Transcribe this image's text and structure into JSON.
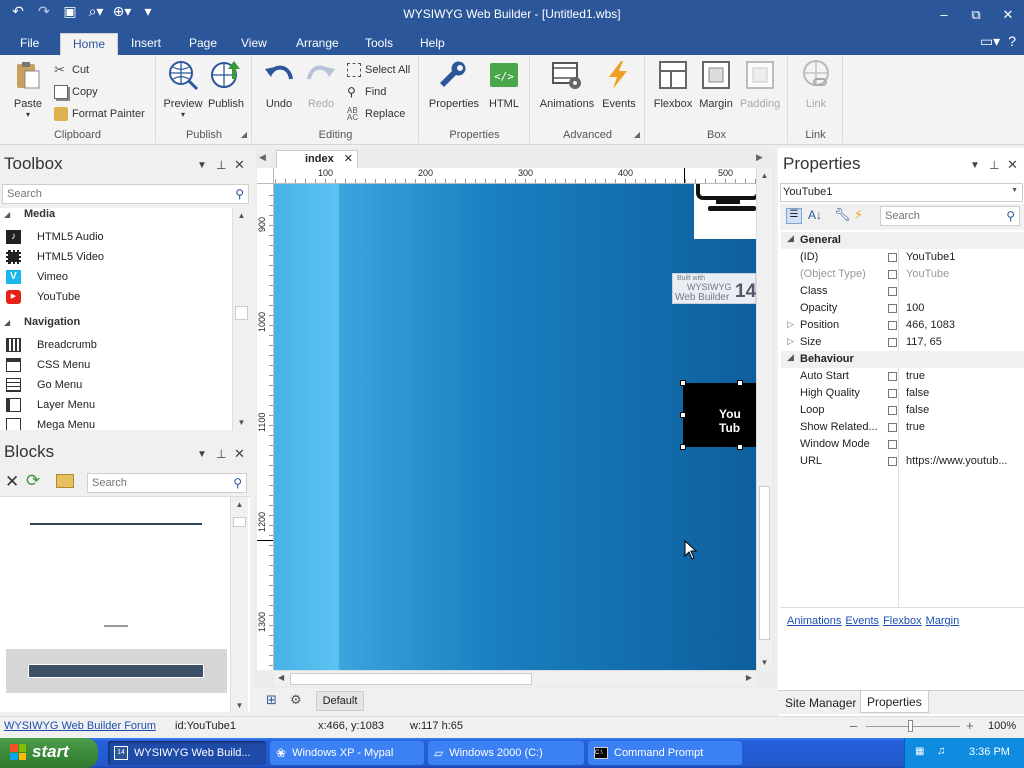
{
  "window": {
    "title": "WYSIWYG Web Builder - [Untitled1.wbs]",
    "controls": [
      "–",
      "⧉",
      "✕"
    ]
  },
  "ribbon_tabs": [
    "File",
    "Home",
    "Insert",
    "Page",
    "View",
    "Arrange",
    "Tools",
    "Help"
  ],
  "ribbon": {
    "clipboard": {
      "label": "Clipboard",
      "paste": "Paste",
      "cut": "Cut",
      "copy": "Copy",
      "format_painter": "Format Painter"
    },
    "publish": {
      "label": "Publish",
      "preview": "Preview",
      "publish": "Publish"
    },
    "editing": {
      "label": "Editing",
      "undo": "Undo",
      "redo": "Redo",
      "select_all": "Select All",
      "find": "Find",
      "replace": "Replace"
    },
    "properties": {
      "label": "Properties",
      "properties": "Properties",
      "html": "HTML"
    },
    "advanced": {
      "label": "Advanced",
      "animations": "Animations",
      "events": "Events"
    },
    "box": {
      "label": "Box",
      "flexbox": "Flexbox",
      "margin": "Margin",
      "padding": "Padding"
    },
    "link": {
      "label": "Link",
      "link": "Link"
    }
  },
  "toolbox": {
    "title": "Toolbox",
    "search_placeholder": "Search",
    "categories": [
      {
        "name": "Media",
        "items": [
          "HTML5 Audio",
          "HTML5 Video",
          "Vimeo",
          "YouTube"
        ]
      },
      {
        "name": "Navigation",
        "items": [
          "Breadcrumb",
          "CSS Menu",
          "Go Menu",
          "Layer Menu",
          "Mega Menu"
        ]
      }
    ]
  },
  "blocks": {
    "title": "Blocks",
    "search_placeholder": "Search"
  },
  "document": {
    "tab_name": "index",
    "ruler_h": [
      "100",
      "200",
      "300",
      "400",
      "500"
    ],
    "ruler_v": [
      "900",
      "1000",
      "1100",
      "1200",
      "1300"
    ],
    "layout_label": "Default",
    "badge_line1": "Built with",
    "badge_line2": "WYSIWYG",
    "badge_line3": "Web Builder",
    "badge_number": "14",
    "youtube_text": "You Tub"
  },
  "properties_panel": {
    "title": "Properties",
    "object_selector": "YouTube1",
    "search_placeholder": "Search",
    "categories": [
      {
        "name": "General",
        "rows": [
          {
            "name": "(ID)",
            "value": "YouTube1",
            "dim": false,
            "expand": false
          },
          {
            "name": "(Object Type)",
            "value": "YouTube",
            "dim": true,
            "expand": false
          },
          {
            "name": "Class",
            "value": "",
            "dim": false,
            "expand": false
          },
          {
            "name": "Opacity",
            "value": "100",
            "dim": false,
            "expand": false
          },
          {
            "name": "Position",
            "value": "466, 1083",
            "dim": false,
            "expand": true
          },
          {
            "name": "Size",
            "value": "117, 65",
            "dim": false,
            "expand": true
          }
        ]
      },
      {
        "name": "Behaviour",
        "rows": [
          {
            "name": "Auto Start",
            "value": "true",
            "dim": false,
            "expand": false
          },
          {
            "name": "High Quality",
            "value": "false",
            "dim": false,
            "expand": false
          },
          {
            "name": "Loop",
            "value": "false",
            "dim": false,
            "expand": false
          },
          {
            "name": "Show Related...",
            "value": "true",
            "dim": false,
            "expand": false
          },
          {
            "name": "Window Mode",
            "value": "",
            "dim": false,
            "expand": false
          },
          {
            "name": "URL",
            "value": "https://www.youtub...",
            "dim": false,
            "expand": false
          }
        ]
      }
    ],
    "links": [
      "Animations",
      "Events",
      "Flexbox",
      "Margin"
    ],
    "bottom_tabs": [
      "Site Manager",
      "Properties"
    ]
  },
  "statusbar": {
    "forum_link": "WYSIWYG Web Builder Forum",
    "id": "id:YouTube1",
    "coords": "x:466, y:1083",
    "dims": "w:117 h:65",
    "zoom": "100%",
    "zoom_minus": "–",
    "zoom_plus": "+"
  },
  "taskbar": {
    "start": "start",
    "tasks": [
      "WYSIWYG Web Build...",
      "Windows XP - Mypal",
      "Windows 2000 (C:)",
      "Command Prompt"
    ],
    "clock": "3:36 PM"
  }
}
